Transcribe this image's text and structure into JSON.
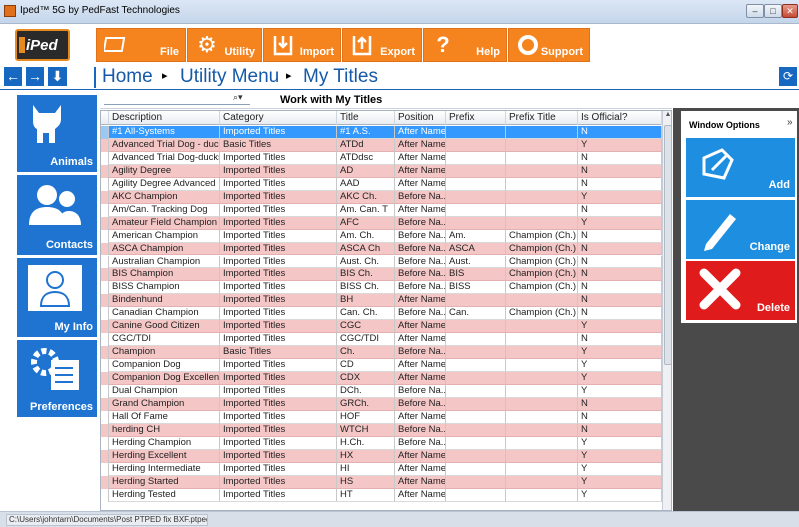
{
  "window": {
    "title": "Iped™ 5G by PedFast Technologies",
    "minimize": "–",
    "maximize": "□",
    "close": "✕"
  },
  "logo": {
    "text": "iPed"
  },
  "toolbar": {
    "file_label": "File",
    "utility_label": "Utility",
    "import_label": "Import",
    "export_label": "Export",
    "help_label": "Help",
    "support_label": "Support"
  },
  "nav": {
    "back": "←",
    "forward": "→",
    "down": "⬇",
    "refresh": "⟳",
    "breadcrumb": [
      "Home",
      "Utility Menu",
      "My Titles"
    ],
    "separator": "▸"
  },
  "sidebar": {
    "items": [
      {
        "label": "Animals",
        "icon": "dog-icon"
      },
      {
        "label": "Contacts",
        "icon": "people-icon"
      },
      {
        "label": "My Info",
        "icon": "person-icon"
      },
      {
        "label": "Preferences",
        "icon": "gear-checklist-icon"
      }
    ]
  },
  "grid": {
    "title": "Work with My Titles",
    "search_value": "",
    "search_icon": "search-icon",
    "columns": [
      "Description",
      "Category",
      "Title",
      "Position",
      "Prefix",
      "Prefix Title",
      "Is Official?"
    ],
    "rows": [
      [
        "#1 All-Systems",
        "Imported Titles",
        "#1 A.S.",
        "After Name",
        "",
        "",
        "N"
      ],
      [
        "Advanced Trial Dog - ducks (...",
        "Basic Titles",
        "ATDd",
        "After Name",
        "",
        "",
        "Y"
      ],
      [
        "Advanced Trial Dog-ducks,sh...",
        "Imported Titles",
        "ATDdsc",
        "After Name",
        "",
        "",
        "N"
      ],
      [
        "Agility Degree",
        "Imported Titles",
        "AD",
        "After Name",
        "",
        "",
        "N"
      ],
      [
        "Agility Degree Advanced",
        "Imported Titles",
        "AAD",
        "After Name",
        "",
        "",
        "N"
      ],
      [
        "AKC Champion",
        "Imported Titles",
        "AKC Ch.",
        "Before Na...",
        "",
        "",
        "Y"
      ],
      [
        "Am/Can. Tracking Dog",
        "Imported Titles",
        "Am. Can. T",
        "After Name",
        "",
        "",
        "N"
      ],
      [
        "Amateur Field Champion",
        "Imported Titles",
        "AFC",
        "Before Na...",
        "",
        "",
        "Y"
      ],
      [
        "American Champion",
        "Imported Titles",
        "Am. Ch.",
        "Before Na...",
        "Am.",
        "Champion (Ch.)",
        "N"
      ],
      [
        "ASCA Champion",
        "Imported Titles",
        "ASCA Ch",
        "Before Na...",
        "ASCA",
        "Champion (Ch.)",
        "N"
      ],
      [
        "Australian Champion",
        "Imported Titles",
        "Aust. Ch.",
        "Before Na...",
        "Aust.",
        "Champion (Ch.)",
        "N"
      ],
      [
        "BIS Champion",
        "Imported Titles",
        "BIS Ch.",
        "Before Na...",
        "BIS",
        "Champion (Ch.)",
        "N"
      ],
      [
        "BISS Champion",
        "Imported Titles",
        "BISS Ch.",
        "Before Na...",
        "BISS",
        "Champion (Ch.)",
        "N"
      ],
      [
        "Bindenhund",
        "Imported Titles",
        "BH",
        "After Name",
        "",
        "",
        "N"
      ],
      [
        "Canadian Champion",
        "Imported Titles",
        "Can. Ch.",
        "Before Na...",
        "Can.",
        "Champion (Ch.)",
        "N"
      ],
      [
        "Canine Good Citizen",
        "Imported Titles",
        "CGC",
        "After Name",
        "",
        "",
        "Y"
      ],
      [
        "CGC/TDI",
        "Imported Titles",
        "CGC/TDI",
        "After Name",
        "",
        "",
        "N"
      ],
      [
        "Champion",
        "Basic Titles",
        "Ch.",
        "Before Na...",
        "",
        "",
        "Y"
      ],
      [
        "Companion Dog",
        "Imported Titles",
        "CD",
        "After Name",
        "",
        "",
        "Y"
      ],
      [
        "Companion Dog Excellent",
        "Imported Titles",
        "CDX",
        "After Name",
        "",
        "",
        "Y"
      ],
      [
        "Dual Champion",
        "Imported Titles",
        "DCh.",
        "Before Na...",
        "",
        "",
        "Y"
      ],
      [
        "Grand Champion",
        "Imported Titles",
        "GRCh.",
        "Before Na...",
        "",
        "",
        "N"
      ],
      [
        "Hall Of Fame",
        "Imported Titles",
        "HOF",
        "After Name",
        "",
        "",
        "N"
      ],
      [
        "herding CH",
        "Imported Titles",
        "WTCH",
        "Before Na...",
        "",
        "",
        "N"
      ],
      [
        "Herding Champion",
        "Imported Titles",
        "H.Ch.",
        "Before Na...",
        "",
        "",
        "Y"
      ],
      [
        "Herding Excellent",
        "Imported Titles",
        "HX",
        "After Name",
        "",
        "",
        "Y"
      ],
      [
        "Herding Intermediate",
        "Imported Titles",
        "HI",
        "After Name",
        "",
        "",
        "Y"
      ],
      [
        "Herding Started",
        "Imported Titles",
        "HS",
        "After Name",
        "",
        "",
        "Y"
      ],
      [
        "Herding Tested",
        "Imported Titles",
        "HT",
        "After Name",
        "",
        "",
        "Y"
      ]
    ]
  },
  "window_options": {
    "title": "Window Options",
    "collapse": "»",
    "add_label": "Add",
    "change_label": "Change",
    "delete_label": "Delete"
  },
  "status": {
    "path": "C:\\Users\\johntarn\\Documents\\Post PTPED fix BXF.ptped"
  },
  "colors": {
    "accent_orange": "#f5841f",
    "tile_blue": "#1e74d0",
    "alt_row_pink": "#f5c6c6",
    "selected_row": "#3399ff",
    "delete_red": "#e01b1b",
    "panel_gray": "#4a4a4a"
  }
}
